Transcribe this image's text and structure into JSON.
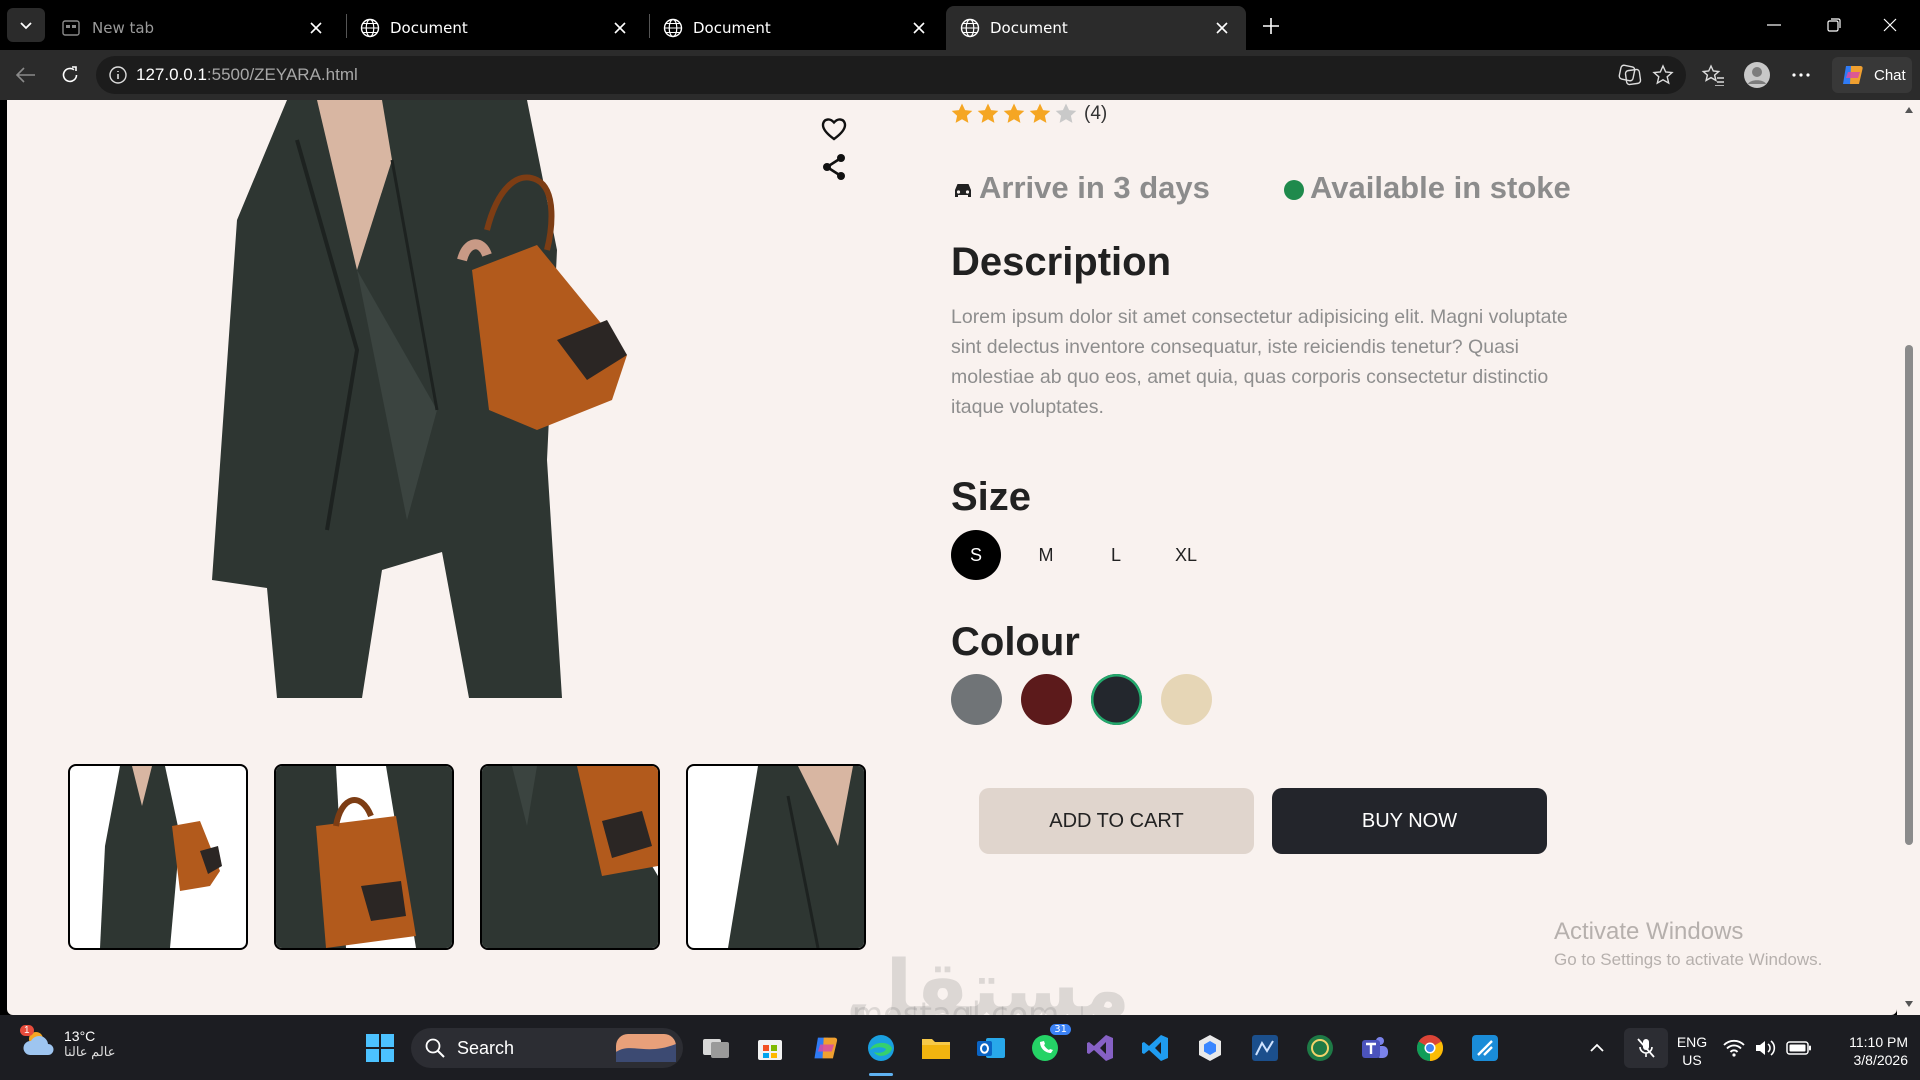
{
  "browser": {
    "tabs": [
      {
        "title": "New tab",
        "active": false
      },
      {
        "title": "Document",
        "active": false
      },
      {
        "title": "Document",
        "active": false
      },
      {
        "title": "Document",
        "active": true
      }
    ],
    "url_host": "127.0.0.1",
    "url_rest": ":5500/ZEYARA.html",
    "chat_label": "Chat"
  },
  "product": {
    "rating": 4,
    "rating_count": "(4)",
    "delivery": "Arrive in 3 days",
    "availability": "Available in stoke",
    "description_title": "Description",
    "description": "Lorem ipsum dolor sit amet consectetur adipisicing elit. Magni voluptate sint delectus inventore consequatur, iste reiciendis tenetur? Quasi molestiae ab quo eos, amet quia, quas corporis consectetur distinctio itaque voluptates.",
    "size_title": "Size",
    "sizes": [
      "S",
      "M",
      "L",
      "XL"
    ],
    "selected_size": "S",
    "colour_title": "Colour",
    "colours": [
      "#707477",
      "#5c1a1b",
      "#23272d",
      "#e6d6b6"
    ],
    "selected_colour": 2,
    "add_to_cart": "ADD TO CART",
    "buy_now": "BUY NOW"
  },
  "overlay": {
    "activate_title": "Activate Windows",
    "activate_sub": "Go to Settings to activate Windows.",
    "watermark": "مستقل",
    "watermark_sub": "mostaql.com"
  },
  "taskbar": {
    "temperature": "13°C",
    "location": "عالم عالنا",
    "weather_badge": "1",
    "search_label": "Search",
    "whatsapp_badge": "31",
    "lang": "ENG",
    "region": "US",
    "time": "11:10 PM",
    "date": "3/8/2026"
  }
}
